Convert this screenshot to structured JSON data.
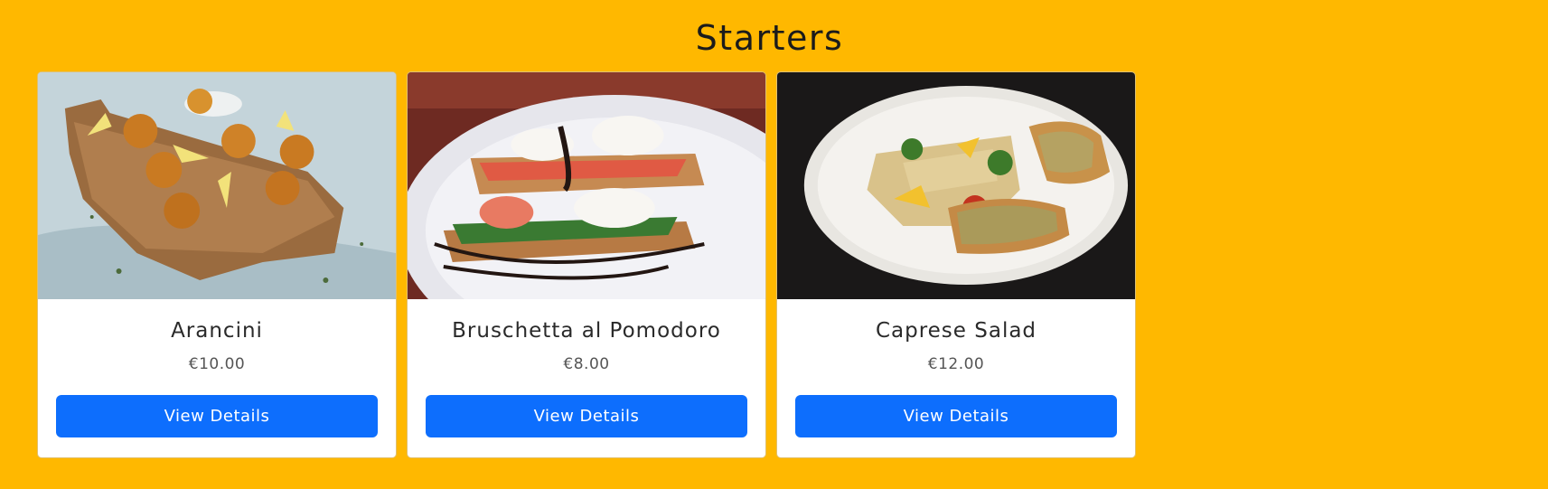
{
  "section": {
    "title": "Starters"
  },
  "theme": {
    "background": "#FFB800",
    "button": "#0D6EFD"
  },
  "items": [
    {
      "name": "Arancini",
      "price": "€10.00",
      "button_label": "View Details",
      "image_icon": "arancini-photo"
    },
    {
      "name": "Bruschetta al Pomodoro",
      "price": "€8.00",
      "button_label": "View Details",
      "image_icon": "bruschetta-photo"
    },
    {
      "name": "Caprese Salad",
      "price": "€12.00",
      "button_label": "View Details",
      "image_icon": "caprese-salad-photo"
    }
  ]
}
